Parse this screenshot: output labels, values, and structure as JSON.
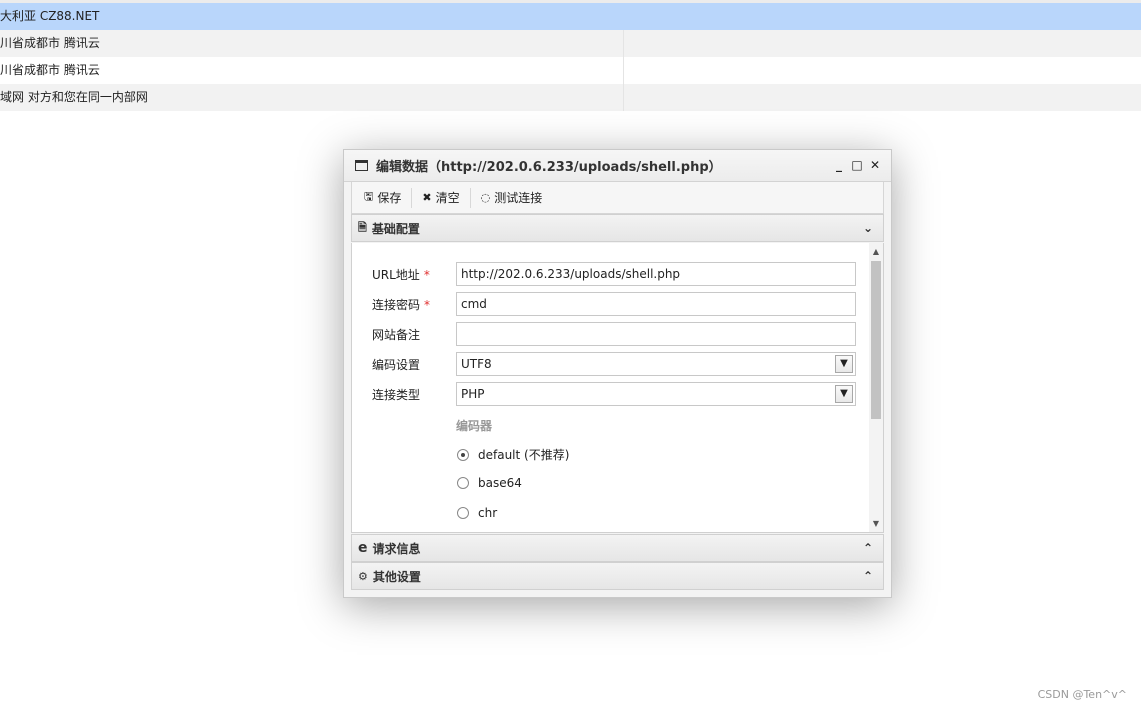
{
  "background_rows": [
    {
      "text": "大利亚 CZ88.NET",
      "selected": true
    },
    {
      "text": "川省成都市 腾讯云"
    },
    {
      "text": "川省成都市 腾讯云"
    },
    {
      "text": "域网 对方和您在同一内部网"
    }
  ],
  "dialog": {
    "title": "编辑数据（http://202.0.6.233/uploads/shell.php）",
    "window_buttons": {
      "minimize": "_",
      "maximize": "□",
      "close": "✕"
    },
    "toolbar": {
      "save": "保存",
      "clear": "清空",
      "test": "测试连接"
    },
    "basic_panel": {
      "title": "基础配置",
      "url_label": "URL地址",
      "url_value": "http://202.0.6.233/uploads/shell.php",
      "password_label": "连接密码",
      "password_value": "cmd",
      "remark_label": "网站备注",
      "remark_value": "",
      "encoding_label": "编码设置",
      "encoding_value": "UTF8",
      "type_label": "连接类型",
      "type_value": "PHP",
      "encoder_heading": "编码器",
      "encoders": [
        "default (不推荐)",
        "base64",
        "chr"
      ],
      "required_mark": "*"
    },
    "request_panel": {
      "title": "请求信息"
    },
    "other_panel": {
      "title": "其他设置"
    }
  },
  "watermark": "CSDN @Ten^v^"
}
